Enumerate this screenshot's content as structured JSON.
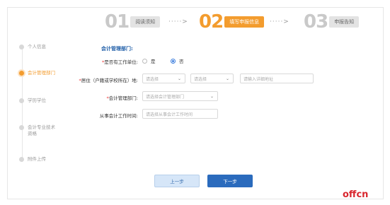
{
  "steps": [
    {
      "num": "01",
      "label": "阅读须知"
    },
    {
      "num": "02",
      "label": "填写申报信息"
    },
    {
      "num": "03",
      "label": "申报告知"
    }
  ],
  "arrows": [
    "·····>",
    "·····>"
  ],
  "sidebar": {
    "items": [
      {
        "label": "个人信息"
      },
      {
        "label": "会计管理部门"
      },
      {
        "label": "学历学位"
      },
      {
        "label": "会计专业技术资格"
      },
      {
        "label": "附件上传"
      }
    ]
  },
  "form": {
    "section_title": "会计管理部门:",
    "work_unit": {
      "label": "是否有工作单位:",
      "options": [
        "是",
        "否"
      ],
      "selected": "否"
    },
    "residence": {
      "label": "居住（户籍或学校所在）地:",
      "province_placeholder": "请选择",
      "city_placeholder": "请选择",
      "address_placeholder": "请输入详细地址"
    },
    "department": {
      "label": "会计管理部门:",
      "placeholder": "请选择会计管理部门"
    },
    "work_time": {
      "label": "从事会计工作时间:",
      "placeholder": "请选择从事会计工作时间"
    }
  },
  "buttons": {
    "prev": "上一步",
    "next": "下一步"
  },
  "watermark": "offcn",
  "colors": {
    "accent": "#f39c2e",
    "primary": "#2b6bbd"
  }
}
